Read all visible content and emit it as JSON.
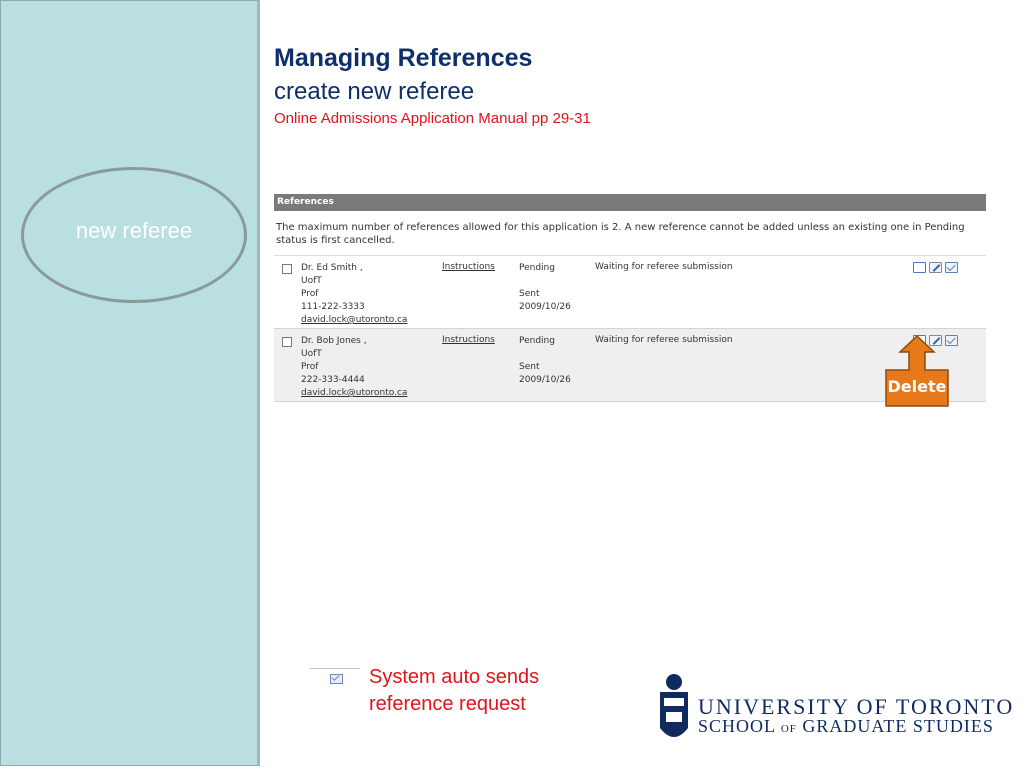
{
  "slide": {
    "title": "Managing References",
    "subtitle": "create new referee",
    "manual_ref": "Online Admissions Application Manual pp 29-31"
  },
  "sidebar": {
    "callout": "new referee"
  },
  "references_panel": {
    "header": "References",
    "message": "The maximum number of references allowed for this application is 2.  A new reference cannot be added unless an existing one in Pending status is first cancelled.",
    "rows": [
      {
        "name": "Dr. Ed Smith ,",
        "org": "UofT",
        "position": "Prof",
        "phone": "111-222-3333",
        "email": "david.lock@utoronto.ca",
        "instructions": "Instructions",
        "status": "Pending",
        "sent_label": "Sent",
        "sent_date": "2009/10/26",
        "message": "Waiting for referee submission"
      },
      {
        "name": "Dr. Bob Jones ,",
        "org": "UofT",
        "position": "Prof",
        "phone": "222-333-4444",
        "email": "david.lock@utoronto.ca",
        "instructions": "Instructions",
        "status": "Pending",
        "sent_label": "Sent",
        "sent_date": "2009/10/26",
        "message": "Waiting for referee submission"
      }
    ],
    "row_icons": [
      "view-icon",
      "edit-icon",
      "email-icon"
    ]
  },
  "callouts": {
    "delete": "Delete",
    "delete_color": "#e8791a",
    "auto_send": "System auto sends reference request"
  },
  "logo": {
    "line1": "UNIVERSITY OF TORONTO",
    "line2_a": "SCHOOL",
    "line2_of": "OF",
    "line2_b": "GRADUATE STUDIES"
  }
}
